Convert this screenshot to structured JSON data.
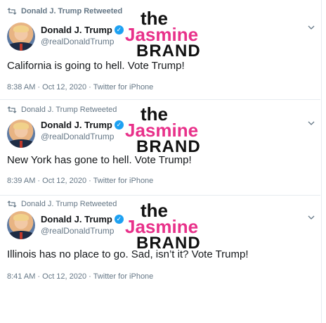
{
  "tweets": [
    {
      "retweet_label": "Donald J. Trump Retweeted",
      "display_name": "Donald J. Trump",
      "handle": "@realDonaldTrump",
      "text": "California is going to hell. Vote Trump!",
      "meta": "8:38 AM · Oct 12, 2020 · Twitter for iPhone"
    },
    {
      "retweet_label": "Donald J. Trump Retweeted",
      "display_name": "Donald J. Trump",
      "handle": "@realDonaldTrump",
      "text": "New York has gone to hell. Vote Trump!",
      "meta": "8:39 AM · Oct 12, 2020 · Twitter for iPhone"
    },
    {
      "retweet_label": "Donald J. Trump Retweeted",
      "display_name": "Donald J. Trump",
      "handle": "@realDonaldTrump",
      "text": "Illinois has no place to go. Sad, isn’t it? Vote Trump!",
      "meta": "8:41 AM · Oct 12, 2020 · Twitter for iPhone"
    }
  ],
  "watermark": {
    "the": "the",
    "jasmine": "Jasmine",
    "brand": "BRAND"
  },
  "icons": {
    "retweet": "retweet-icon",
    "verified": "verified-icon",
    "menu": "chevron-down-icon"
  },
  "colors": {
    "verified": "#1da1f2",
    "muted": "#657786",
    "watermark_accent": "#e8318a"
  }
}
